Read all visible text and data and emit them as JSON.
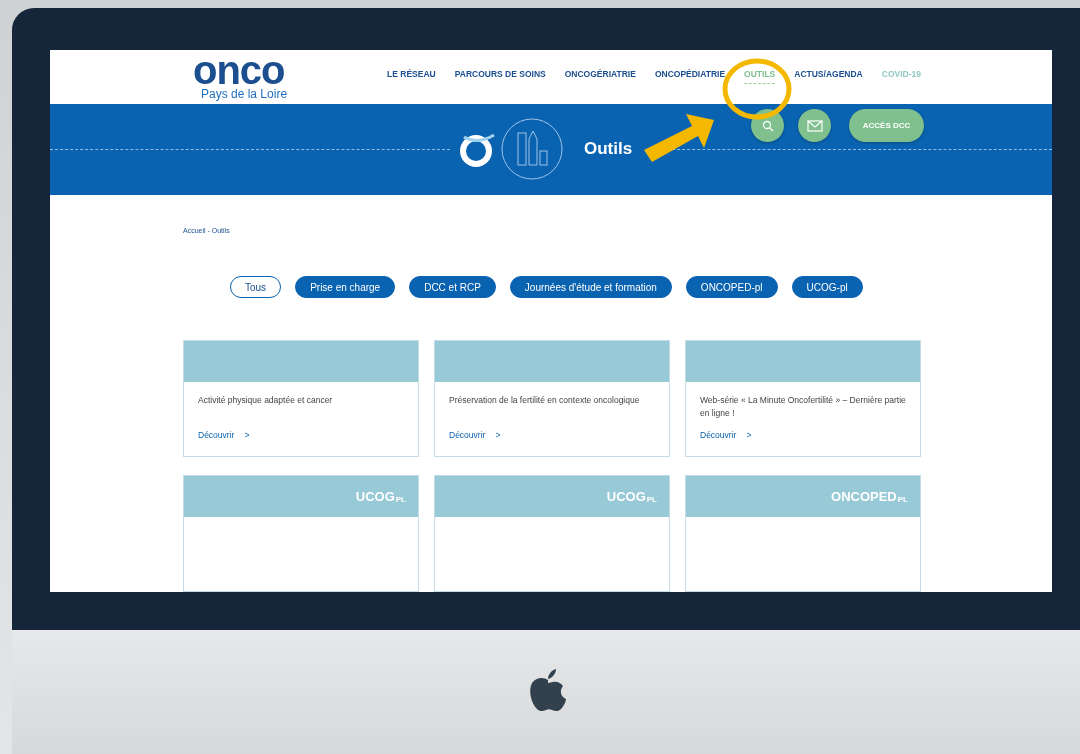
{
  "logo": {
    "wordmark": "onco",
    "subtitle": "Pays de la Loire"
  },
  "nav": [
    {
      "label": "LE RÉSEAU",
      "selected": false,
      "faded": false
    },
    {
      "label": "PARCOURS DE SOINS",
      "selected": false,
      "faded": false
    },
    {
      "label": "ONCOGÉRIATRIE",
      "selected": false,
      "faded": false
    },
    {
      "label": "ONCOPÉDIATRIE",
      "selected": false,
      "faded": false
    },
    {
      "label": "OUTILS",
      "selected": true,
      "faded": false
    },
    {
      "label": "ACTUS/AGENDA",
      "selected": false,
      "faded": false
    },
    {
      "label": "COVID-19",
      "selected": false,
      "faded": true
    }
  ],
  "access_button": "ACCÈS DCC",
  "banner": {
    "title": "Outils"
  },
  "breadcrumb": "Accueil - Outils",
  "filters": [
    {
      "label": "Tous",
      "selected": true
    },
    {
      "label": "Prise en charge",
      "selected": false
    },
    {
      "label": "DCC et RCP",
      "selected": false
    },
    {
      "label": "Journées d'étude et formation",
      "selected": false
    },
    {
      "label": "ONCOPED-pl",
      "selected": false
    },
    {
      "label": "UCOG-pl",
      "selected": false
    }
  ],
  "cards": [
    {
      "title": "Activité physique adaptée et cancer",
      "link": "Découvrir",
      "arrow": ">"
    },
    {
      "title": "Préservation de la fertilité en contexte oncologique",
      "link": "Découvrir",
      "arrow": ">"
    },
    {
      "title": "Web-série « La Minute Oncofertilité » – Dernière partie en ligne !",
      "link": "Découvrir",
      "arrow": ">"
    }
  ],
  "logo_cards": [
    {
      "logo": "UCOG",
      "suffix": "PL"
    },
    {
      "logo": "UCOG",
      "suffix": "PL"
    },
    {
      "logo": "ONCOPED",
      "suffix": "PL"
    }
  ]
}
